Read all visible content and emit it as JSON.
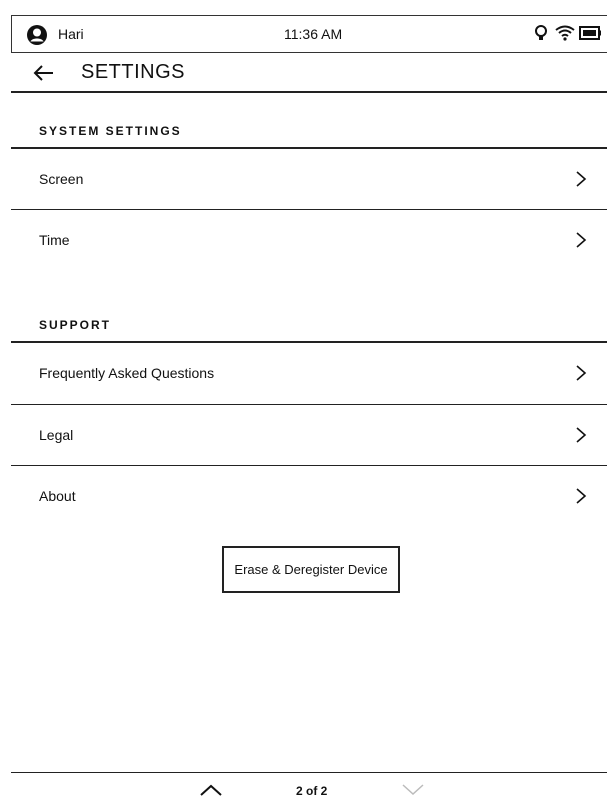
{
  "status_bar": {
    "user_name": "Hari",
    "time": "11:36 AM",
    "icons": [
      "avatar-icon",
      "light-bulb-icon",
      "wifi-icon",
      "battery-icon"
    ]
  },
  "header": {
    "title": "SETTINGS",
    "back_icon": "back-arrow-icon"
  },
  "sections": {
    "system": {
      "title": "SYSTEM SETTINGS",
      "items": [
        {
          "label": "Screen"
        },
        {
          "label": "Time"
        }
      ]
    },
    "support": {
      "title": "SUPPORT",
      "items": [
        {
          "label": "Frequently Asked Questions"
        },
        {
          "label": "Legal"
        },
        {
          "label": "About"
        }
      ]
    }
  },
  "erase_button": {
    "label": "Erase & Deregister Device"
  },
  "pagination": {
    "label": "2 of 2",
    "prev_icon": "chevron-up-icon",
    "next_icon": "chevron-down-icon"
  }
}
